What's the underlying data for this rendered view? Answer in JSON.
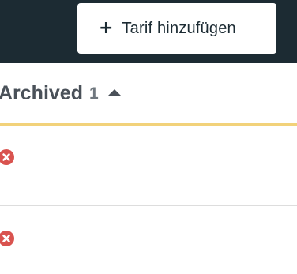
{
  "toolbar": {
    "add_tariff_label": "Tarif hinzufügen",
    "add_icon": "plus-icon"
  },
  "archived": {
    "title": "Archived",
    "count": "1",
    "toggle_icon": "caret-up-icon",
    "rows": [
      {
        "icon": "remove-icon",
        "icon_color": "#d9534f"
      },
      {
        "icon": "remove-icon",
        "icon_color": "#d9534f"
      }
    ]
  },
  "colors": {
    "topbar": "#1c2b33",
    "accent_line": "#f2d27a",
    "remove": "#d9534f"
  }
}
